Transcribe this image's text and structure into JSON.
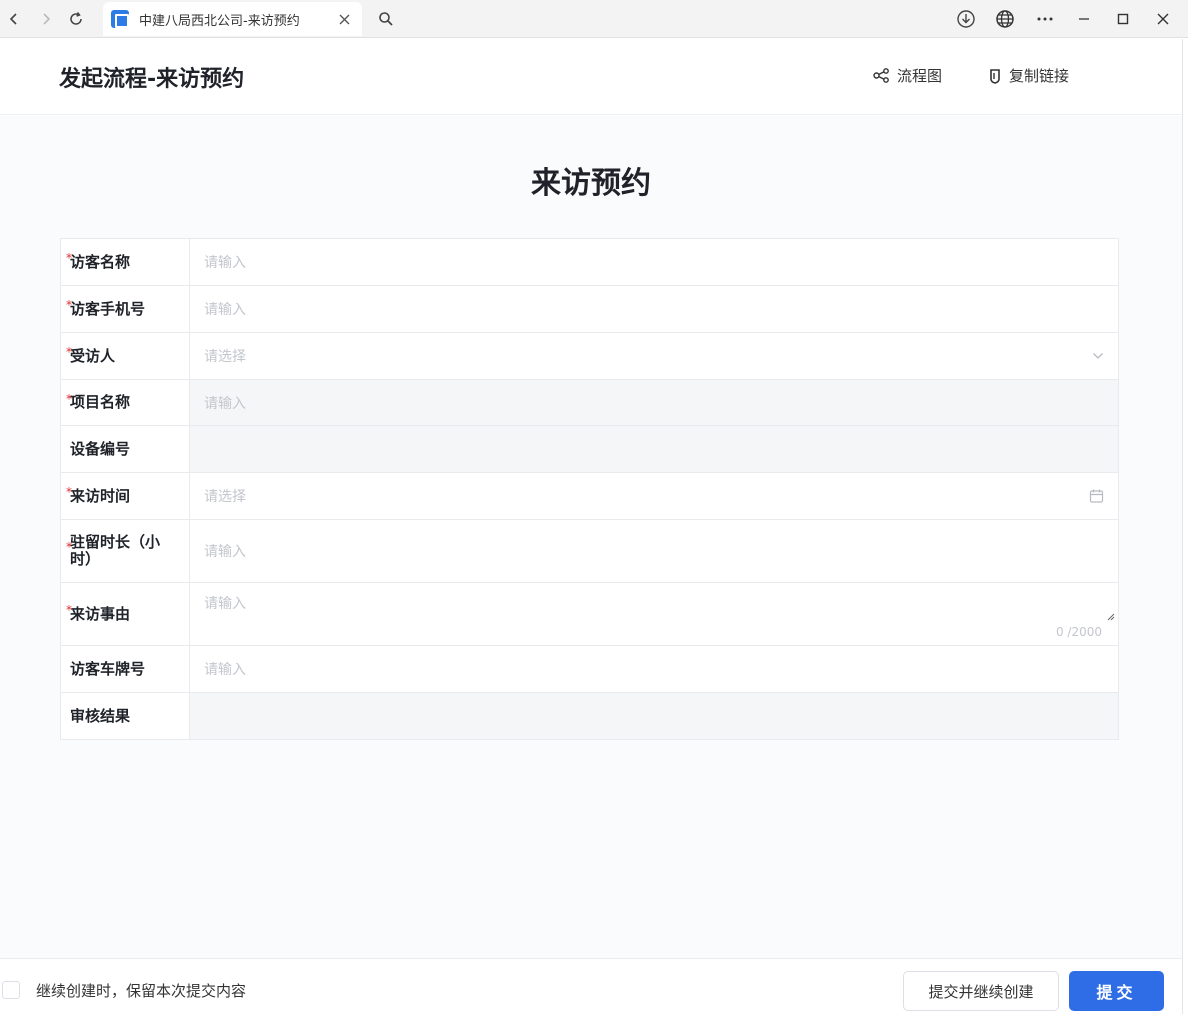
{
  "browser": {
    "tab_title": "中建八局西北公司-来访预约",
    "tab_close_glyph": "×"
  },
  "header": {
    "title": "发起流程-来访预约",
    "flowchart_label": "流程图",
    "copy_link_label": "复制链接"
  },
  "form": {
    "title": "来访预约",
    "fields": [
      {
        "label": "访客名称",
        "placeholder": "请输入",
        "required": true
      },
      {
        "label": "访客手机号",
        "placeholder": "请输入",
        "required": true
      },
      {
        "label": "受访人",
        "placeholder": "请选择",
        "required": true
      },
      {
        "label": "项目名称",
        "placeholder": "请输入",
        "required": true
      },
      {
        "label": "设备编号",
        "placeholder": "",
        "required": false
      },
      {
        "label": "来访时间",
        "placeholder": "请选择",
        "required": true
      },
      {
        "label": "驻留时长（小时）",
        "placeholder": "请输入",
        "required": true
      },
      {
        "label": "来访事由",
        "placeholder": "请输入",
        "required": true,
        "counter": "0 /2000"
      },
      {
        "label": "访客车牌号",
        "placeholder": "请输入",
        "required": false
      },
      {
        "label": "审核结果",
        "placeholder": "",
        "required": false
      }
    ]
  },
  "footer": {
    "keep_content_label": "继续创建时，保留本次提交内容",
    "submit_continue_label": "提交并继续创建",
    "submit_label": "提交"
  },
  "colors": {
    "primary": "#2e6de6",
    "required": "#e02f2f"
  }
}
